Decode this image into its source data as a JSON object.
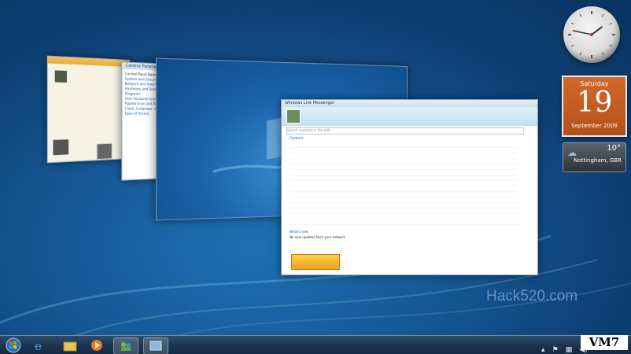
{
  "desktop": {
    "watermark": "Hack520.com",
    "badge": "VM7"
  },
  "gadgets": {
    "clock": {
      "hour": 1,
      "minute": 47
    },
    "calendar": {
      "weekday": "Saturday",
      "day": "19",
      "month_year": "September 2009"
    },
    "weather": {
      "temperature": "10°",
      "location": "Nottingham, GBR"
    }
  },
  "windows": {
    "control_panel": {
      "address": "Control Panel ▸ System and Security",
      "nav_items": [
        "Control Panel Home",
        "System and Security",
        "Network and Internet",
        "Hardware and Sound",
        "Programs",
        "User Accounts and Family Safety",
        "Appearance and Personalization",
        "Clock, Language, and Region",
        "Ease of Access"
      ]
    },
    "live_messenger": {
      "title": "Windows Live Messenger",
      "search_placeholder": "Search contacts or the web...",
      "contacts_header": "Contacts",
      "whats_new": "What's new",
      "whats_new_note": "No new updates from your network"
    }
  },
  "taskbar": {
    "items": [
      "start-orb",
      "internet-explorer",
      "windows-explorer",
      "media-player",
      "messenger",
      "control-panel"
    ]
  },
  "colors": {
    "desktop_blue": "#165a98",
    "calendar_orange": "#c45d22",
    "taskbar": "#1b3450"
  }
}
